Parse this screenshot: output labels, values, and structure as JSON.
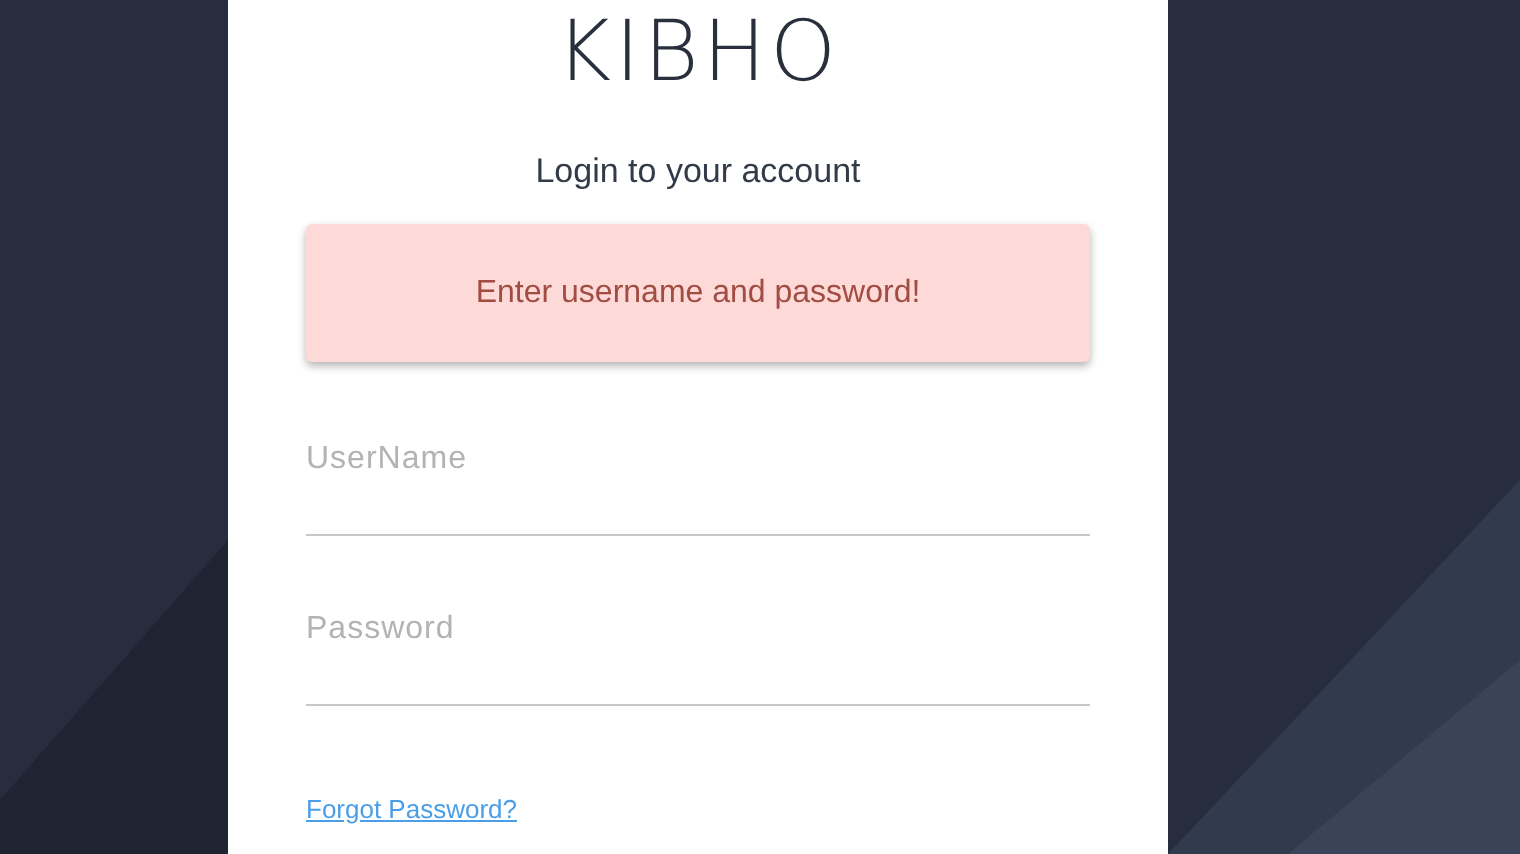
{
  "logo": "KIBHO",
  "heading": "Login to your account",
  "alert": {
    "message": "Enter username and password!"
  },
  "fields": [
    {
      "placeholder": "UserName"
    },
    {
      "placeholder": "Password"
    }
  ],
  "forgot_link": "Forgot Password?"
}
